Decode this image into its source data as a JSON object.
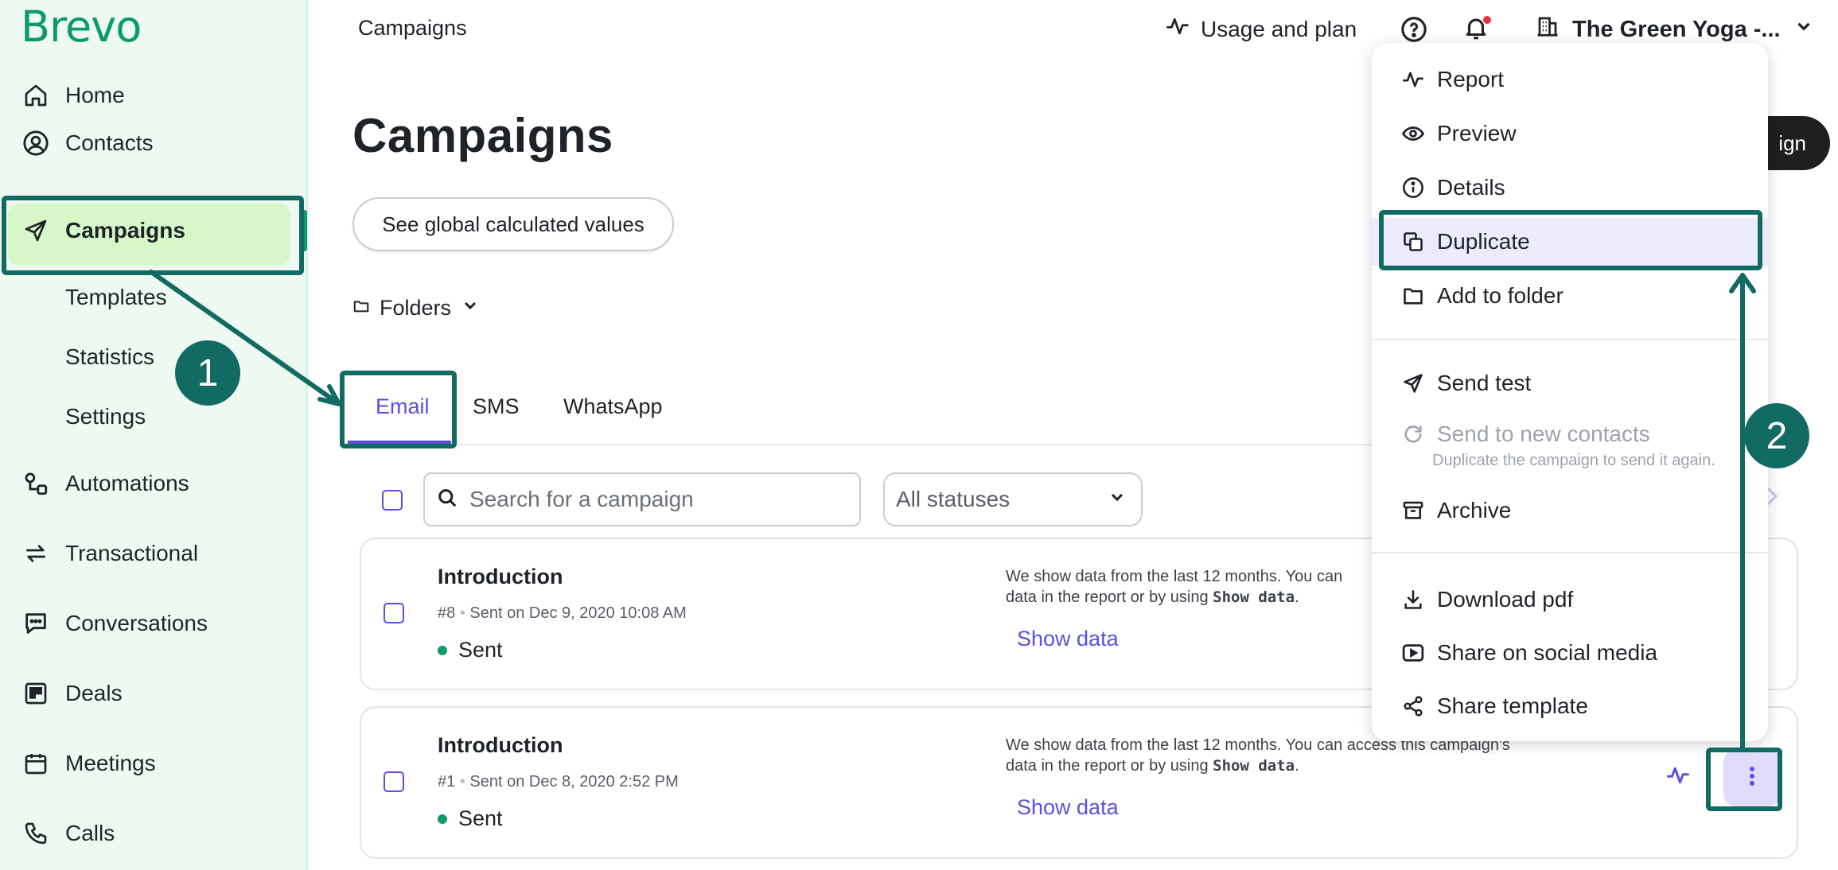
{
  "brand": {
    "logo_text": "Brevo",
    "accent": "#0b996e",
    "link_color": "#5b4ee0",
    "annotation_color": "#126b62"
  },
  "sidebar": {
    "items": [
      {
        "label": "Home",
        "icon": "home-icon"
      },
      {
        "label": "Contacts",
        "icon": "contacts-icon"
      },
      {
        "label": "Campaigns",
        "icon": "send-icon",
        "active": true
      },
      {
        "label": "Automations",
        "icon": "automations-icon"
      },
      {
        "label": "Transactional",
        "icon": "transactional-icon"
      },
      {
        "label": "Conversations",
        "icon": "conversations-icon"
      },
      {
        "label": "Deals",
        "icon": "deals-icon"
      },
      {
        "label": "Meetings",
        "icon": "calendar-icon"
      },
      {
        "label": "Calls",
        "icon": "phone-icon"
      }
    ],
    "sub_items": [
      "Templates",
      "Statistics",
      "Settings"
    ]
  },
  "topbar": {
    "breadcrumb": "Campaigns",
    "usage_label": "Usage and plan",
    "account_name": "The Green Yoga -..."
  },
  "main": {
    "title": "Campaigns",
    "global_values_label": "See global calculated values",
    "folders_label": "Folders",
    "create_label_fragment": "ign",
    "tabs": [
      "Email",
      "SMS",
      "WhatsApp"
    ],
    "search_placeholder": "Search for a campaign",
    "status_filter": "All statuses"
  },
  "campaigns": [
    {
      "title": "Introduction",
      "number": "#8",
      "sent_info": "Sent on Dec 9, 2020 10:08 AM",
      "status": "Sent",
      "note_line1": "We show data from the last 12 months. You can",
      "note_line2_pre": "data in the report or by using ",
      "note_bold": "Show data",
      "note_end": ".",
      "show_data": "Show data"
    },
    {
      "title": "Introduction",
      "number": "#1",
      "sent_info": "Sent on Dec 8, 2020 2:52 PM",
      "status": "Sent",
      "note_line1": "We show data from the last 12 months. You can access this campaign's",
      "note_line2_pre": "data in the report or by using ",
      "note_bold": "Show data",
      "note_end": ".",
      "show_data": "Show data"
    }
  ],
  "dropdown": {
    "items": [
      {
        "label": "Report",
        "icon": "activity-icon"
      },
      {
        "label": "Preview",
        "icon": "eye-icon"
      },
      {
        "label": "Details",
        "icon": "info-icon"
      },
      {
        "label": "Duplicate",
        "icon": "duplicate-icon"
      },
      {
        "label": "Add to folder",
        "icon": "folder-icon"
      },
      {
        "label": "Send test",
        "icon": "send-icon"
      },
      {
        "label": "Send to new contacts",
        "icon": "refresh-icon",
        "disabled": true
      },
      {
        "label": "Archive",
        "icon": "archive-icon"
      },
      {
        "label": "Download pdf",
        "icon": "download-icon"
      },
      {
        "label": "Share on social media",
        "icon": "video-icon"
      },
      {
        "label": "Share template",
        "icon": "share-icon"
      }
    ],
    "send_to_new_hint": "Duplicate the campaign to send it again."
  },
  "annotations": {
    "step1": "1",
    "step2": "2"
  }
}
